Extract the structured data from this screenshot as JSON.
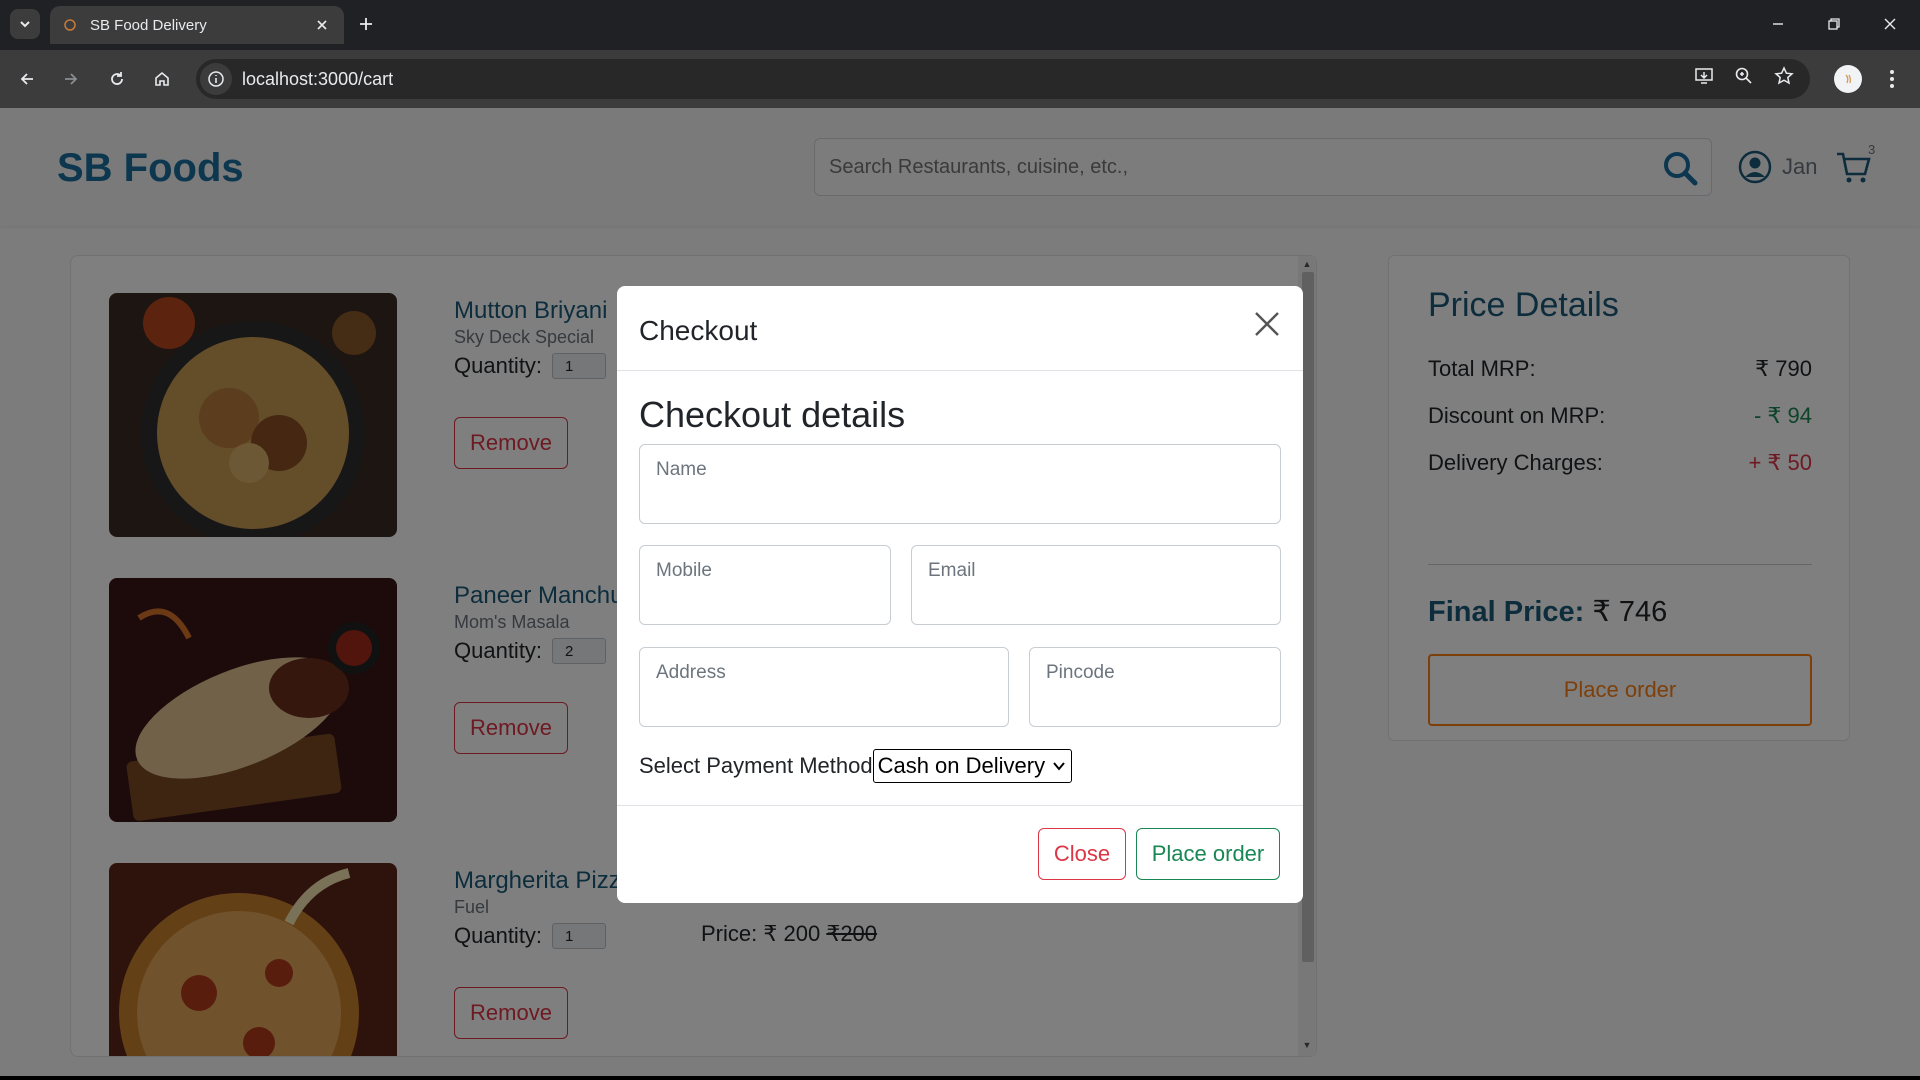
{
  "browser": {
    "tab_title": "SB Food Delivery",
    "url": "localhost:3000/cart"
  },
  "navbar": {
    "brand": "SB Foods",
    "search_placeholder": "Search Restaurants, cuisine, etc.,",
    "user_name": "Jan",
    "cart_count": "3"
  },
  "cart": {
    "quantity_label": "Quantity:",
    "remove_label": "Remove",
    "items": [
      {
        "name": "Mutton Briyani",
        "restaurant": "Sky Deck Special",
        "quantity": "1"
      },
      {
        "name": "Paneer Manchurian",
        "restaurant": "Mom's Masala",
        "quantity": "2"
      },
      {
        "name": "Margherita Pizza",
        "restaurant": "Fuel",
        "quantity": "1",
        "price_label": "Price:",
        "price": "₹ 200",
        "old_price": "₹200"
      }
    ]
  },
  "price_details": {
    "title": "Price Details",
    "total_mrp_label": "Total MRP:",
    "total_mrp": "₹ 790",
    "discount_label": "Discount on MRP:",
    "discount": "- ₹ 94",
    "delivery_label": "Delivery Charges:",
    "delivery": "+ ₹ 50",
    "final_label": "Final Price:",
    "final_value": "₹ 746",
    "place_order_label": "Place order"
  },
  "modal": {
    "title": "Checkout",
    "heading": "Checkout details",
    "fields": {
      "name": "Name",
      "mobile": "Mobile",
      "email": "Email",
      "address": "Address",
      "pincode": "Pincode"
    },
    "payment_label": "Select Payment Method",
    "payment_selected": "Cash on Delivery",
    "close_label": "Close",
    "submit_label": "Place order"
  },
  "colors": {
    "brand": "#1b6f9d",
    "danger": "#dc3545",
    "success": "#198754",
    "accent": "#fd7e14"
  }
}
